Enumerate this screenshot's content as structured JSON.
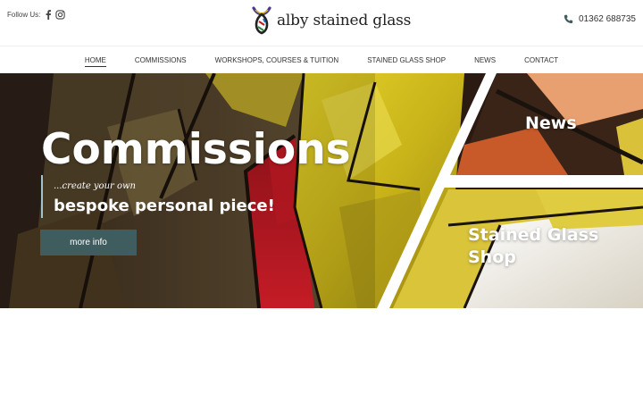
{
  "header": {
    "follow_label": "Follow Us:",
    "social": [
      {
        "icon": "facebook-icon"
      },
      {
        "icon": "instagram-icon"
      }
    ],
    "logo_text": "alby stained glass",
    "phone": "01362 688735"
  },
  "nav": {
    "items": [
      {
        "label": "HOME",
        "active": true
      },
      {
        "label": "COMMISSIONS",
        "active": false
      },
      {
        "label": "WORKSHOPS, COURSES & TUITION",
        "active": false
      },
      {
        "label": "STAINED GLASS SHOP",
        "active": false
      },
      {
        "label": "NEWS",
        "active": false
      },
      {
        "label": "CONTACT",
        "active": false
      }
    ]
  },
  "hero": {
    "title": "Commissions",
    "subtitle": "...create your own",
    "tagline": "bespoke personal piece!",
    "button_label": "more info",
    "panels": {
      "news": "News",
      "shop": "Stained Glass Shop"
    }
  },
  "colors": {
    "button": "#3f5d5f",
    "accent_bar": "#9fc4d0",
    "glass_yellow": "#d6c21e",
    "glass_red": "#c01a22"
  }
}
